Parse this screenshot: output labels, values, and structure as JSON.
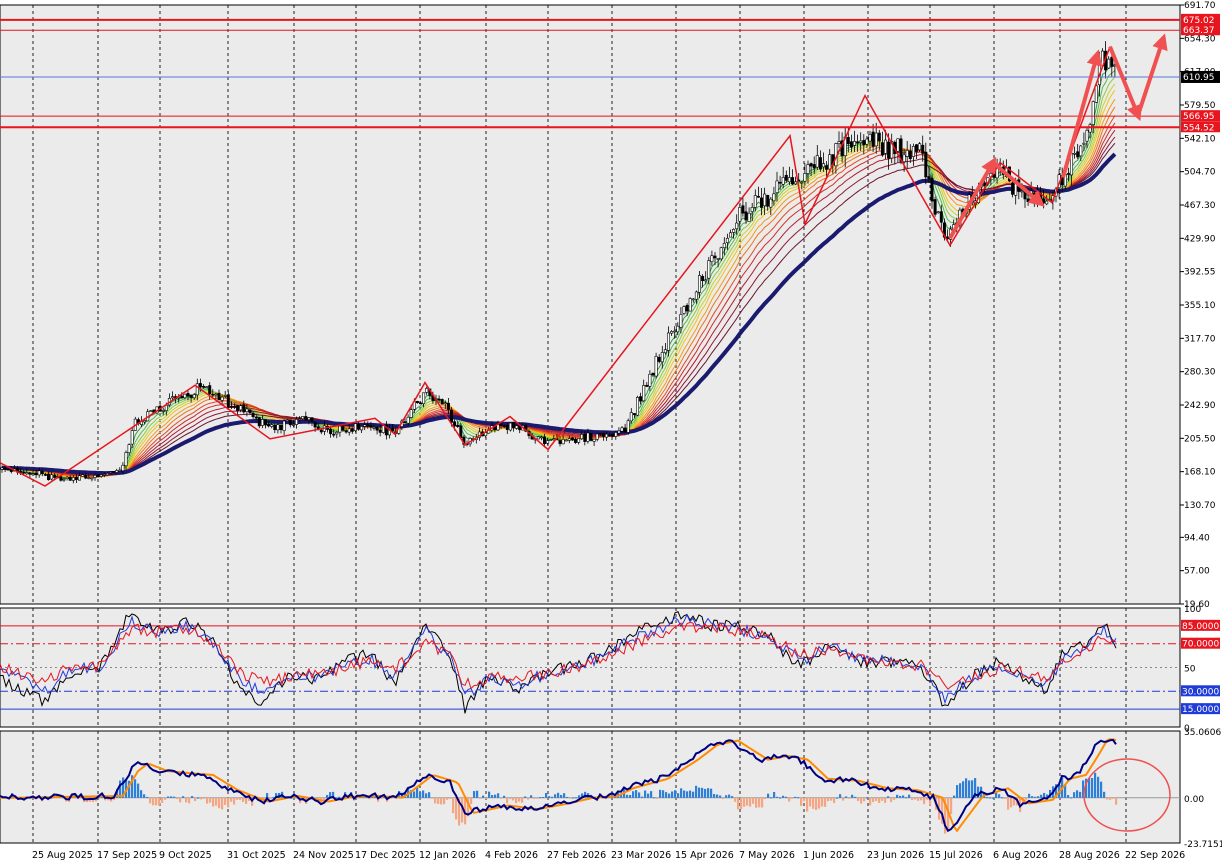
{
  "chart_data": [
    {
      "type": "candlestick",
      "panel": "price",
      "y_ticks": [
        691.7,
        654.3,
        617.0,
        579.5,
        542.1,
        504.7,
        467.3,
        429.9,
        392.55,
        355.1,
        317.7,
        280.3,
        242.9,
        205.5,
        168.1,
        130.7,
        94.4,
        57.0,
        19.6
      ],
      "y_tick_labels": [
        "691.70",
        "654.30",
        "617.00",
        "579.50",
        "542.10",
        "504.70",
        "467.30",
        "429.90",
        "392.55",
        "355.10",
        "317.70",
        "280.30",
        "242.90",
        "205.50",
        "168.10",
        "130.70",
        "94.40",
        "57.00",
        "19.60"
      ],
      "ylim": [
        19.6,
        691.7
      ],
      "price_lines": [
        {
          "value": 675.02,
          "label": "675.02",
          "color": "#e8141e"
        },
        {
          "value": 663.37,
          "label": "663.37",
          "color": "#e8141e"
        },
        {
          "value": 566.95,
          "label": "566.95",
          "color": "#e8141e"
        },
        {
          "value": 554.52,
          "label": "554.52",
          "color": "#e8141e"
        }
      ],
      "current_price": {
        "value": 610.95,
        "label": "610.95",
        "color": "#5577dd"
      },
      "ma_anchor_closes": [
        [
          0,
          170
        ],
        [
          30,
          168
        ],
        [
          60,
          158
        ],
        [
          90,
          162
        ],
        [
          120,
          168
        ],
        [
          135,
          225
        ],
        [
          160,
          240
        ],
        [
          200,
          262
        ],
        [
          240,
          240
        ],
        [
          270,
          215
        ],
        [
          300,
          228
        ],
        [
          330,
          214
        ],
        [
          360,
          220
        ],
        [
          395,
          212
        ],
        [
          425,
          258
        ],
        [
          445,
          240
        ],
        [
          465,
          200
        ],
        [
          490,
          215
        ],
        [
          515,
          220
        ],
        [
          545,
          200
        ],
        [
          575,
          205
        ],
        [
          600,
          210
        ],
        [
          625,
          215
        ],
        [
          660,
          300
        ],
        [
          700,
          380
        ],
        [
          735,
          450
        ],
        [
          760,
          470
        ],
        [
          790,
          500
        ],
        [
          830,
          518
        ],
        [
          860,
          545
        ],
        [
          890,
          530
        ],
        [
          920,
          525
        ],
        [
          945,
          430
        ],
        [
          975,
          480
        ],
        [
          1000,
          510
        ],
        [
          1020,
          480
        ],
        [
          1045,
          470
        ],
        [
          1065,
          505
        ],
        [
          1085,
          540
        ],
        [
          1098,
          620
        ],
        [
          1110,
          640
        ],
        [
          1118,
          610
        ]
      ],
      "zigzag": [
        [
          0,
          178
        ],
        [
          45,
          152
        ],
        [
          195,
          265
        ],
        [
          270,
          205
        ],
        [
          375,
          228
        ],
        [
          395,
          210
        ],
        [
          425,
          268
        ],
        [
          465,
          198
        ],
        [
          510,
          230
        ],
        [
          548,
          193
        ],
        [
          790,
          545
        ],
        [
          805,
          446
        ],
        [
          865,
          590
        ],
        [
          905,
          510
        ],
        [
          950,
          422
        ],
        [
          1000,
          515
        ],
        [
          1052,
          470
        ],
        [
          1110,
          645
        ]
      ],
      "arrows": [
        {
          "from": [
            950,
            430
          ],
          "to": [
            993,
            515
          ]
        },
        {
          "from": [
            993,
            515
          ],
          "to": [
            1040,
            470
          ]
        },
        {
          "from": [
            1063,
            498
          ],
          "to": [
            1097,
            635
          ]
        },
        {
          "from": [
            1110,
            645
          ],
          "to": [
            1138,
            568
          ]
        },
        {
          "from": [
            1138,
            568
          ],
          "to": [
            1163,
            653
          ]
        }
      ],
      "x_tick_labels": [
        "25 Aug 2025",
        "17 Sep 2025",
        "9 Oct 2025",
        "31 Oct 2025",
        "24 Nov 2025",
        "17 Dec 2025",
        "12 Jan 2026",
        "4 Feb 2026",
        "27 Feb 2026",
        "23 Mar 2026",
        "15 Apr 2026",
        "7 May 2026",
        "1 Jun 2026",
        "23 Jun 2026",
        "15 Jul 2026",
        "6 Aug 2026",
        "28 Aug 2026",
        "22 Sep 2026"
      ]
    },
    {
      "type": "line",
      "panel": "oscillator",
      "ylim": [
        0,
        100
      ],
      "y_tick_labels": [
        "100",
        "50",
        "0"
      ],
      "levels": [
        {
          "value": 85,
          "label": "85.0000",
          "color": "#e8141e",
          "style": "solid"
        },
        {
          "value": 70,
          "label": "70.0000",
          "color": "#e8141e",
          "style": "dashdot"
        },
        {
          "value": 30,
          "label": "30.0000",
          "color": "#1f3bd8",
          "style": "dashdot"
        },
        {
          "value": 15,
          "label": "15.0000",
          "color": "#1f3bd8",
          "style": "solid"
        }
      ],
      "series": [
        {
          "color": "#000000",
          "anchors": [
            [
              0,
              40
            ],
            [
              20,
              30
            ],
            [
              45,
              22
            ],
            [
              70,
              45
            ],
            [
              100,
              50
            ],
            [
              130,
              95
            ],
            [
              160,
              80
            ],
            [
              190,
              88
            ],
            [
              215,
              70
            ],
            [
              240,
              30
            ],
            [
              265,
              20
            ],
            [
              290,
              45
            ],
            [
              320,
              40
            ],
            [
              345,
              55
            ],
            [
              370,
              62
            ],
            [
              395,
              35
            ],
            [
              425,
              88
            ],
            [
              450,
              60
            ],
            [
              465,
              15
            ],
            [
              490,
              45
            ],
            [
              515,
              30
            ],
            [
              545,
              45
            ],
            [
              575,
              52
            ],
            [
              600,
              60
            ],
            [
              625,
              72
            ],
            [
              655,
              88
            ],
            [
              685,
              95
            ],
            [
              710,
              85
            ],
            [
              740,
              85
            ],
            [
              770,
              75
            ],
            [
              800,
              50
            ],
            [
              830,
              72
            ],
            [
              860,
              55
            ],
            [
              890,
              55
            ],
            [
              920,
              52
            ],
            [
              945,
              18
            ],
            [
              975,
              45
            ],
            [
              1000,
              55
            ],
            [
              1020,
              45
            ],
            [
              1045,
              30
            ],
            [
              1065,
              65
            ],
            [
              1090,
              72
            ],
            [
              1105,
              88
            ],
            [
              1118,
              68
            ]
          ]
        },
        {
          "color": "#1f3bd8",
          "anchors": [
            [
              0,
              45
            ],
            [
              20,
              40
            ],
            [
              45,
              30
            ],
            [
              70,
              48
            ],
            [
              100,
              50
            ],
            [
              130,
              88
            ],
            [
              160,
              80
            ],
            [
              190,
              85
            ],
            [
              215,
              70
            ],
            [
              240,
              38
            ],
            [
              265,
              30
            ],
            [
              290,
              42
            ],
            [
              320,
              42
            ],
            [
              345,
              52
            ],
            [
              370,
              58
            ],
            [
              395,
              42
            ],
            [
              425,
              80
            ],
            [
              450,
              60
            ],
            [
              465,
              25
            ],
            [
              490,
              42
            ],
            [
              515,
              35
            ],
            [
              545,
              45
            ],
            [
              575,
              50
            ],
            [
              600,
              58
            ],
            [
              625,
              70
            ],
            [
              655,
              82
            ],
            [
              685,
              90
            ],
            [
              710,
              86
            ],
            [
              740,
              82
            ],
            [
              770,
              75
            ],
            [
              800,
              55
            ],
            [
              830,
              68
            ],
            [
              860,
              58
            ],
            [
              890,
              55
            ],
            [
              920,
              52
            ],
            [
              945,
              25
            ],
            [
              975,
              42
            ],
            [
              1000,
              52
            ],
            [
              1020,
              45
            ],
            [
              1045,
              35
            ],
            [
              1065,
              60
            ],
            [
              1090,
              72
            ],
            [
              1105,
              82
            ],
            [
              1118,
              70
            ]
          ]
        },
        {
          "color": "#e8141e",
          "anchors": [
            [
              0,
              50
            ],
            [
              20,
              45
            ],
            [
              45,
              38
            ],
            [
              70,
              50
            ],
            [
              100,
              50
            ],
            [
              130,
              82
            ],
            [
              160,
              80
            ],
            [
              190,
              82
            ],
            [
              215,
              70
            ],
            [
              240,
              45
            ],
            [
              265,
              38
            ],
            [
              290,
              42
            ],
            [
              320,
              45
            ],
            [
              345,
              50
            ],
            [
              370,
              55
            ],
            [
              395,
              48
            ],
            [
              425,
              72
            ],
            [
              450,
              60
            ],
            [
              465,
              35
            ],
            [
              490,
              42
            ],
            [
              515,
              40
            ],
            [
              545,
              45
            ],
            [
              575,
              50
            ],
            [
              600,
              55
            ],
            [
              625,
              66
            ],
            [
              655,
              78
            ],
            [
              685,
              85
            ],
            [
              710,
              84
            ],
            [
              740,
              80
            ],
            [
              770,
              75
            ],
            [
              800,
              60
            ],
            [
              830,
              65
            ],
            [
              860,
              58
            ],
            [
              890,
              55
            ],
            [
              920,
              52
            ],
            [
              945,
              35
            ],
            [
              975,
              42
            ],
            [
              1000,
              50
            ],
            [
              1020,
              46
            ],
            [
              1045,
              40
            ],
            [
              1065,
              55
            ],
            [
              1090,
              68
            ],
            [
              1105,
              75
            ],
            [
              1118,
              70
            ]
          ]
        }
      ]
    },
    {
      "type": "bar",
      "panel": "momentum",
      "ylim": [
        -23.7151,
        35.0606
      ],
      "y_tick_labels": [
        "35.0606",
        "0.00",
        "-23.7151"
      ],
      "series": [
        {
          "name": "",
          "color": "#000080"
        },
        {
          "name": "",
          "color": "#ff8c00"
        }
      ],
      "histogram_colors": {
        "positive": "#2e7fd8",
        "negative": "#f4a582"
      },
      "anchors": [
        [
          0,
          0
        ],
        [
          60,
          0.5
        ],
        [
          115,
          1
        ],
        [
          130,
          14
        ],
        [
          140,
          18
        ],
        [
          160,
          14
        ],
        [
          180,
          13
        ],
        [
          205,
          12
        ],
        [
          230,
          4
        ],
        [
          260,
          -2
        ],
        [
          290,
          1
        ],
        [
          320,
          -2
        ],
        [
          345,
          0.5
        ],
        [
          370,
          1
        ],
        [
          395,
          0
        ],
        [
          425,
          12
        ],
        [
          450,
          8
        ],
        [
          465,
          -8
        ],
        [
          500,
          -4
        ],
        [
          530,
          -6
        ],
        [
          560,
          -3
        ],
        [
          585,
          0
        ],
        [
          610,
          1
        ],
        [
          625,
          5
        ],
        [
          660,
          10
        ],
        [
          690,
          20
        ],
        [
          710,
          28
        ],
        [
          730,
          30
        ],
        [
          760,
          20
        ],
        [
          780,
          22
        ],
        [
          800,
          20
        ],
        [
          820,
          10
        ],
        [
          850,
          9
        ],
        [
          880,
          5
        ],
        [
          910,
          4
        ],
        [
          935,
          0
        ],
        [
          948,
          -18
        ],
        [
          975,
          1
        ],
        [
          1000,
          5
        ],
        [
          1020,
          -3
        ],
        [
          1045,
          -1
        ],
        [
          1062,
          10
        ],
        [
          1078,
          12
        ],
        [
          1090,
          22
        ],
        [
          1100,
          31
        ],
        [
          1112,
          30
        ],
        [
          1120,
          25
        ]
      ],
      "annotation": "ellipse"
    }
  ],
  "colors": {
    "background": "#ebebeb",
    "axis_background": "#ffffff",
    "candle_up": "#1f7a3a",
    "candle_down": "#d01818",
    "slow_ma": "#1a1a6e",
    "annotation": "#e8141e"
  }
}
